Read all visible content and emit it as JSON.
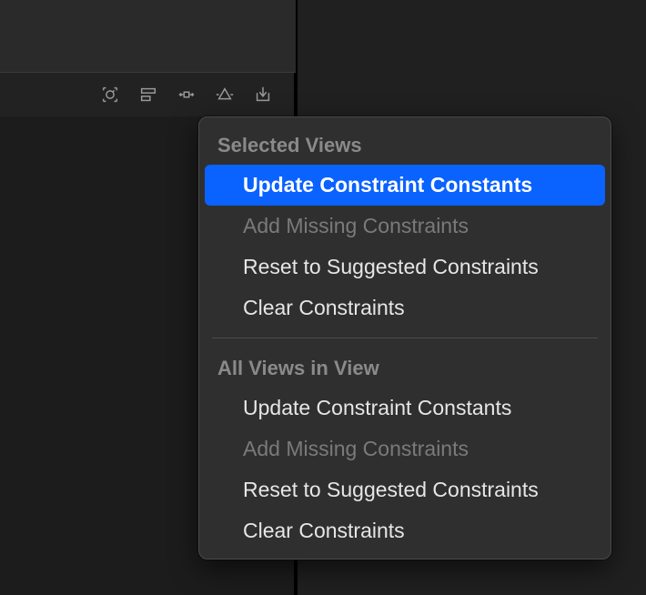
{
  "toolbar": {
    "icons": [
      "update-frames-icon",
      "align-icon",
      "pin-icon",
      "resolve-issues-icon",
      "embed-icon"
    ]
  },
  "popup": {
    "sections": [
      {
        "title": "Selected Views",
        "items": [
          {
            "label": "Update Constraint Constants",
            "enabled": true,
            "highlighted": true
          },
          {
            "label": "Add Missing Constraints",
            "enabled": false,
            "highlighted": false
          },
          {
            "label": "Reset to Suggested Constraints",
            "enabled": true,
            "highlighted": false
          },
          {
            "label": "Clear Constraints",
            "enabled": true,
            "highlighted": false
          }
        ]
      },
      {
        "title": "All Views in View",
        "items": [
          {
            "label": "Update Constraint Constants",
            "enabled": true,
            "highlighted": false
          },
          {
            "label": "Add Missing Constraints",
            "enabled": false,
            "highlighted": false
          },
          {
            "label": "Reset to Suggested Constraints",
            "enabled": true,
            "highlighted": false
          },
          {
            "label": "Clear Constraints",
            "enabled": true,
            "highlighted": false
          }
        ]
      }
    ]
  }
}
